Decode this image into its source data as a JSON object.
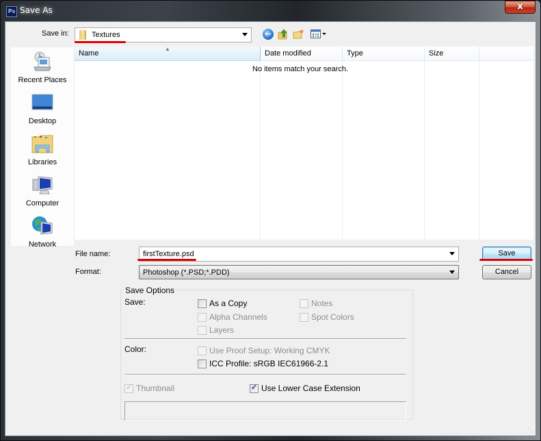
{
  "window": {
    "title": "Save As",
    "app_icon": "photoshop-icon",
    "app_icon_text": "Ps",
    "close_label": "x"
  },
  "toolbar": {
    "save_in_label": "Save in:",
    "save_in_value": "Textures",
    "icons": [
      "back-icon",
      "up-folder-icon",
      "new-folder-icon",
      "views-menu-icon"
    ]
  },
  "sidebar": {
    "items": [
      {
        "label": "Recent Places",
        "icon": "recent-places-icon"
      },
      {
        "label": "Desktop",
        "icon": "desktop-icon"
      },
      {
        "label": "Libraries",
        "icon": "libraries-icon"
      },
      {
        "label": "Computer",
        "icon": "computer-icon"
      },
      {
        "label": "Network",
        "icon": "network-icon"
      }
    ]
  },
  "file_list": {
    "columns": [
      "Name",
      "Date modified",
      "Type",
      "Size"
    ],
    "sorted_column": "Name",
    "empty_message": "No items match your search.",
    "rows": []
  },
  "form": {
    "file_name_label": "File name:",
    "file_name_value": "firstTexture.psd",
    "format_label": "Format:",
    "format_value": "Photoshop (*.PSD;*.PDD)"
  },
  "buttons": {
    "save": "Save",
    "cancel": "Cancel"
  },
  "save_options": {
    "title": "Save Options",
    "save_label": "Save:",
    "color_label": "Color:",
    "checkboxes": {
      "as_a_copy": {
        "label": "As a Copy",
        "checked": false,
        "enabled": true
      },
      "notes": {
        "label": "Notes",
        "checked": false,
        "enabled": false
      },
      "alpha_channels": {
        "label": "Alpha Channels",
        "checked": false,
        "enabled": false
      },
      "spot_colors": {
        "label": "Spot Colors",
        "checked": false,
        "enabled": false
      },
      "layers": {
        "label": "Layers",
        "checked": false,
        "enabled": false
      },
      "use_proof_setup": {
        "label": "Use Proof Setup:  Working CMYK",
        "checked": false,
        "enabled": false
      },
      "icc_profile": {
        "label": "ICC Profile:  sRGB IEC61966-2.1",
        "checked": false,
        "enabled": true
      },
      "thumbnail": {
        "label": "Thumbnail",
        "checked": true,
        "enabled": false
      },
      "lower_case_ext": {
        "label": "Use Lower Case Extension",
        "checked": true,
        "enabled": true
      }
    },
    "status_text": ""
  },
  "annotations": {
    "highlight_color": "#e00000"
  }
}
